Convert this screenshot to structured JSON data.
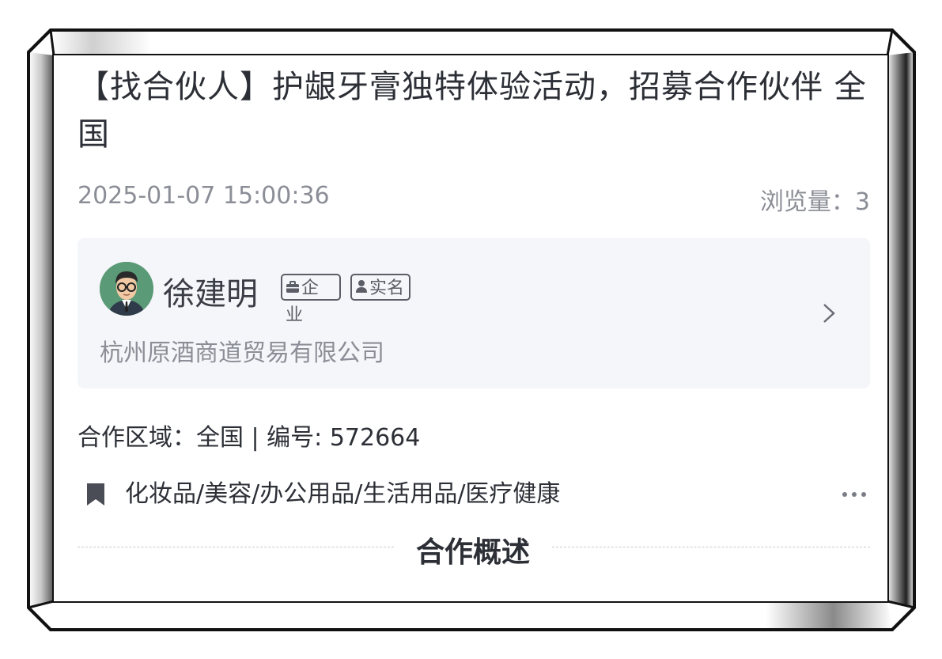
{
  "post": {
    "title": "【找合伙人】护龈牙膏独特体验活动，招募合作伙伴 全国",
    "date": "2025-01-07 15:00:36",
    "views_label": "浏览量：",
    "views_count": "3"
  },
  "publisher": {
    "name": "徐建明",
    "badge_company": "企业",
    "badge_realname": "实名",
    "company": "杭州原酒商道贸易有限公司"
  },
  "meta": {
    "line": "合作区域：全国 | 编号: 572664",
    "categories": "化妆品/美容/办公用品/生活用品/医疗健康"
  },
  "section": {
    "title": "合作概述"
  },
  "colors": {
    "text_primary": "#2c2f36",
    "text_secondary": "#8b8e96",
    "panel_bg": "#f5f6fa",
    "avatar_bg": "#5b9a77"
  },
  "icons": [
    "briefcase-icon",
    "person-icon",
    "chevron-right-icon",
    "bookmark-icon",
    "more-icon"
  ]
}
